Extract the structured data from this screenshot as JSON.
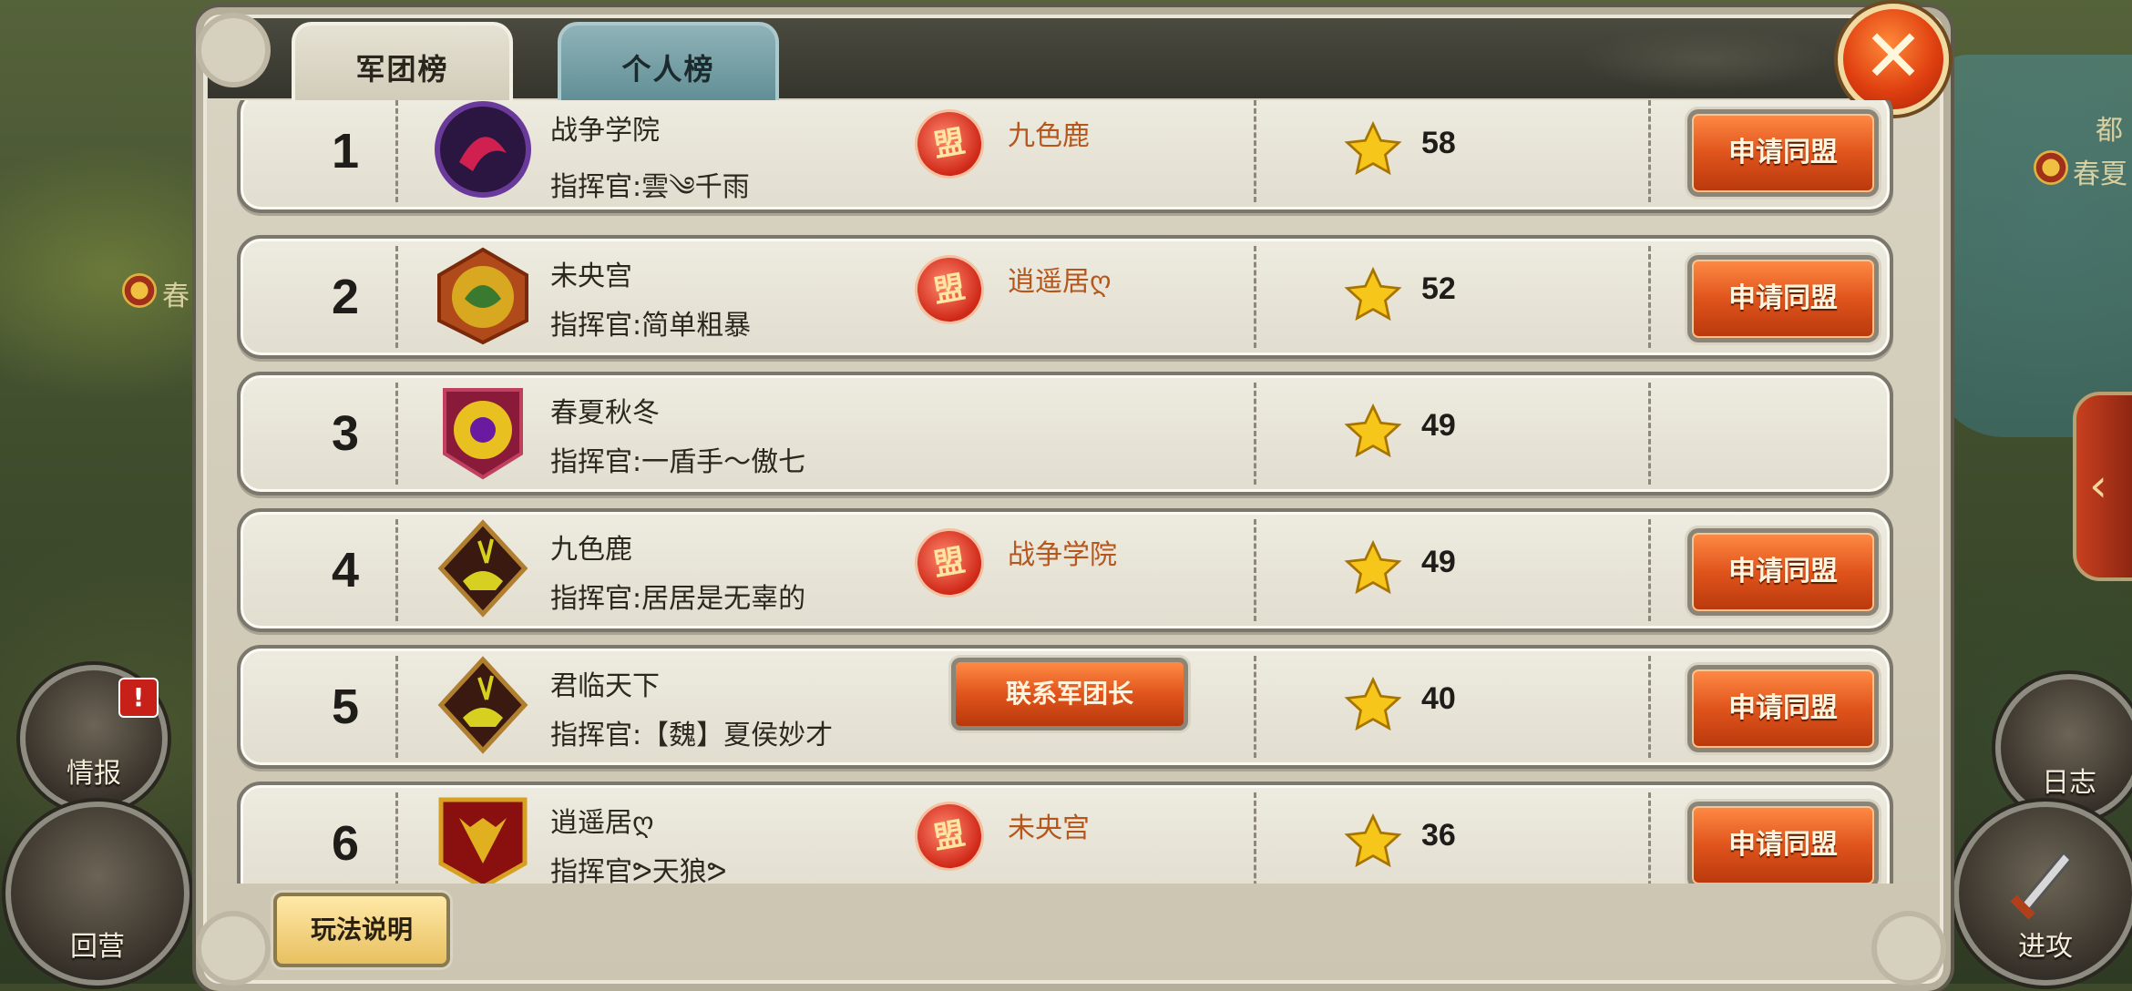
{
  "tabs": {
    "legion": "军团榜",
    "personal": "个人榜"
  },
  "close_icon": "✕",
  "meng_icon": "盟",
  "rows": [
    {
      "rank": "1",
      "name": "战争学院",
      "commander": "指挥官:雲༄千雨",
      "alliance": "九色鹿",
      "score": "58",
      "action": "申请同盟",
      "emblem": "purple-dragon"
    },
    {
      "rank": "2",
      "name": "未央宫",
      "commander": "指挥官:简单粗暴",
      "alliance": "逍遥居ღ",
      "score": "52",
      "action": "申请同盟",
      "emblem": "green-dragon"
    },
    {
      "rank": "3",
      "name": "春夏秋冬",
      "commander": "指挥官:一盾手～傲七",
      "alliance": "",
      "score": "49",
      "action": "",
      "emblem": "phoenix"
    },
    {
      "rank": "4",
      "name": "九色鹿",
      "commander": "指挥官:居居是无辜的",
      "alliance": "战争学院",
      "score": "49",
      "action": "申请同盟",
      "emblem": "deer"
    },
    {
      "rank": "5",
      "name": "君临天下",
      "commander": "指挥官:【魏】夏侯妙才",
      "contact": "联系军团长",
      "score": "40",
      "action": "申请同盟",
      "emblem": "deer"
    },
    {
      "rank": "6",
      "name": "逍遥居ღ",
      "commander": "指挥官ᕗ天狼ᕗ",
      "alliance": "未央宫",
      "score": "36",
      "action": "申请同盟",
      "emblem": "red-beast"
    }
  ],
  "footer": {
    "rules": "玩法说明"
  },
  "map": {
    "label_top_right": "都",
    "label_right": "春夏",
    "label_left": "春"
  },
  "side": {
    "intel": "情报",
    "intel_alert": "!",
    "back": "回营",
    "log": "日志",
    "attack": "进攻"
  },
  "colors": {
    "accent_orange": "#e0541c",
    "alliance_text": "#b5561c",
    "tab_inactive": "#5f8d94"
  }
}
